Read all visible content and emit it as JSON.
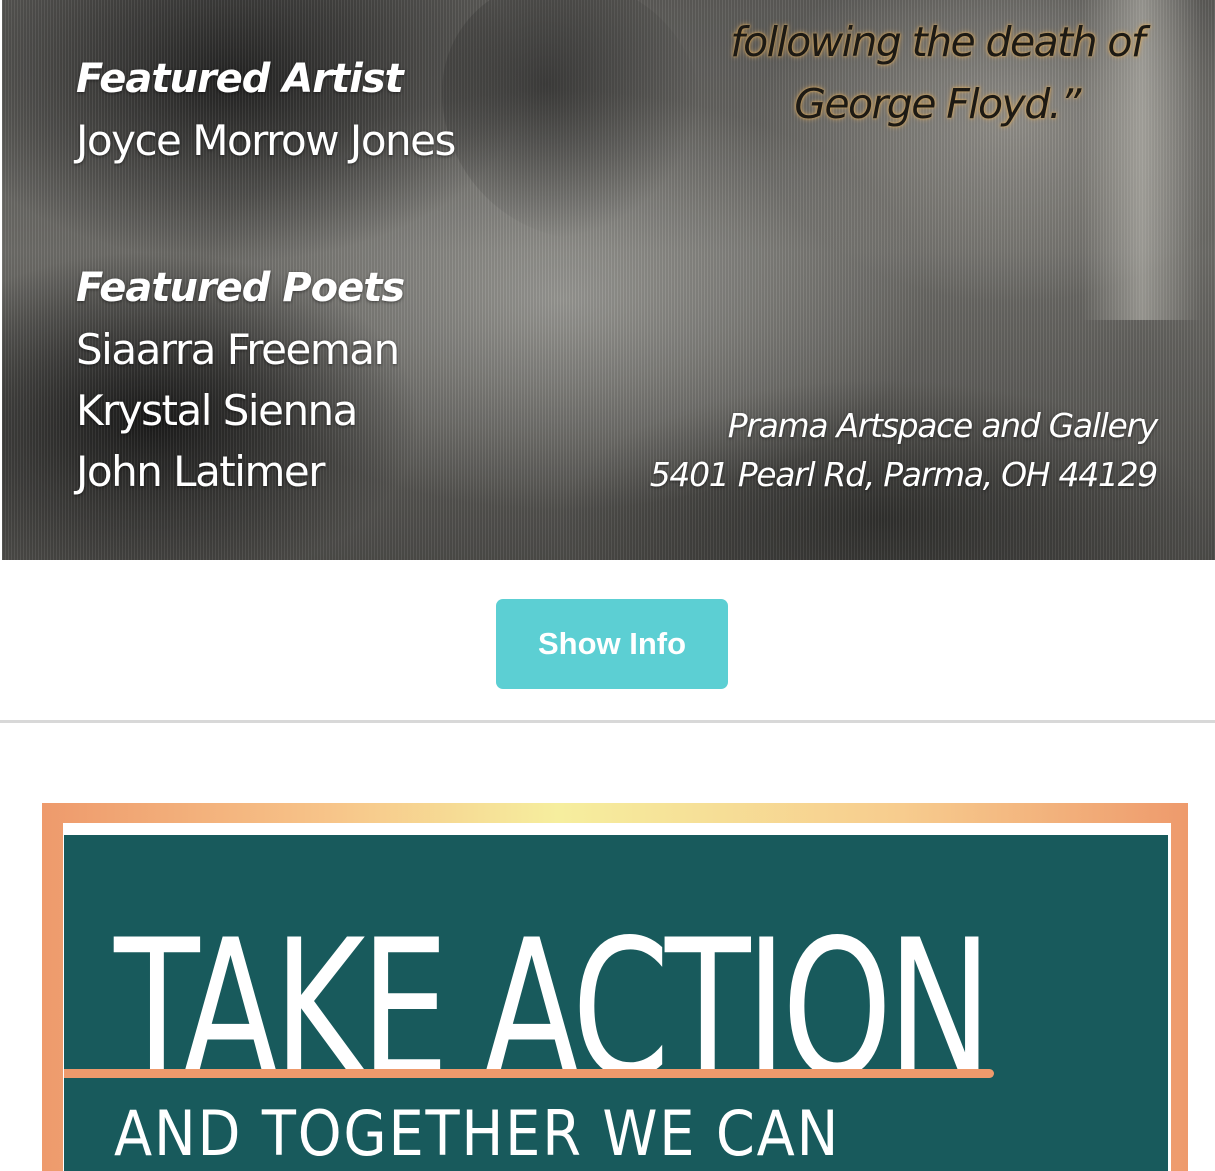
{
  "poster": {
    "quote_line1": "following the death of",
    "quote_line2": "George Floyd.”",
    "artist_heading": "Featured Artist",
    "artist_name": "Joyce Morrow Jones",
    "poets_heading": "Featured Poets",
    "poets": [
      "Siaarra Freeman",
      "Krystal Sienna",
      "John Latimer"
    ],
    "venue_name": "Prama Artspace and Gallery",
    "venue_address": "5401 Pearl Rd, Parma, OH 44129"
  },
  "show_info_button": {
    "label": "Show Info",
    "color": "#5ccfd3"
  },
  "take_action": {
    "title": "TAKE ACTION",
    "subtitle": "AND TOGETHER WE CAN",
    "panel_color": "#185a5c",
    "accent_color": "#ee9a6c"
  }
}
